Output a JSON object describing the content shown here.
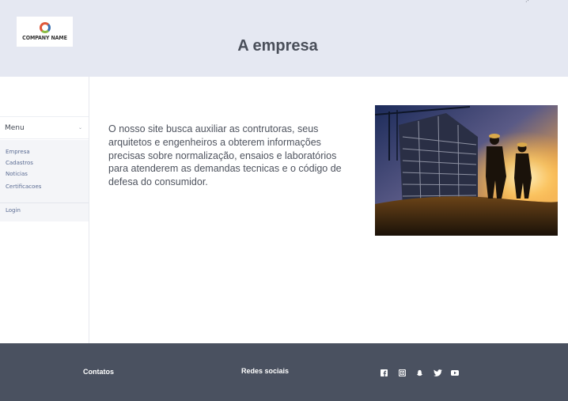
{
  "header": {
    "logo_text": "COMPANY NAME",
    "title": "A empresa",
    "corner_mark": "·'"
  },
  "sidebar": {
    "menu_label": "Menu",
    "chevron": "⌄",
    "items": [
      {
        "label": "Empresa"
      },
      {
        "label": "Cadastros"
      },
      {
        "label": "Noticias"
      },
      {
        "label": "Certificacoes"
      }
    ],
    "login_label": "Login"
  },
  "main": {
    "intro_text": "O nosso site busca auxiliar as contrutoras, seus arquitetos e engenheiros a obterem informações precisas sobre normalização, ensaios e laboratórios para atenderem as demandas tecnicas e o código de defesa do consumidor."
  },
  "footer": {
    "contacts_label": "Contatos",
    "social_label": "Redes sociais",
    "social_icons": [
      "facebook-icon",
      "instagram-icon",
      "snapchat-icon",
      "twitter-icon",
      "youtube-icon"
    ]
  },
  "colors": {
    "header_bg": "#e5e8f2",
    "footer_bg": "#4a5160",
    "menu_link": "#5b6c93"
  }
}
